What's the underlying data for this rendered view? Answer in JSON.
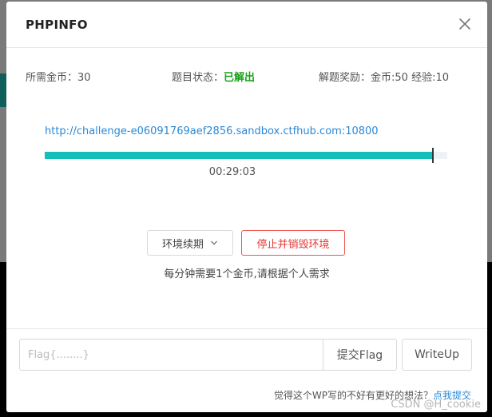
{
  "modal": {
    "title": "PHPINFO"
  },
  "info": {
    "coins_label": "所需金币：",
    "coins_value": "30",
    "status_label": "题目状态：",
    "status_value": "已解出",
    "reward_label": "解题奖励：",
    "reward_value": "金币:50 经验:10"
  },
  "challenge": {
    "url": "http://challenge-e06091769aef2856.sandbox.ctfhub.com:10800",
    "progress": 0.965,
    "timer": "00:29:03"
  },
  "actions": {
    "extend_label": "环境续期",
    "destroy_label": "停止并销毁环境",
    "hint": "每分钟需要1个金币,请根据个人需求"
  },
  "flag": {
    "placeholder": "Flag{........}",
    "value": "",
    "submit_label": "提交Flag",
    "writeup_label": "WriteUp"
  },
  "feedback": {
    "text": "觉得这个WP写的不好有更好的想法？",
    "link_text": "点我提交"
  },
  "watermark": "CSDN @H_cookie",
  "colors": {
    "accent": "#13bfb8",
    "solved": "#19a119",
    "danger": "#e53935",
    "link": "#2b88d8"
  }
}
